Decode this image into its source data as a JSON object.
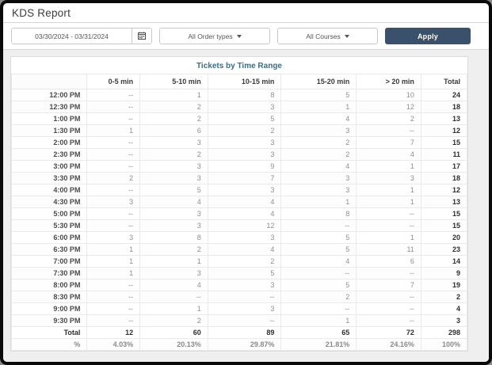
{
  "header": {
    "title": "KDS Report"
  },
  "toolbar": {
    "date_range": "03/30/2024 - 03/31/2024",
    "order_types_label": "All Order types",
    "courses_label": "All Courses",
    "apply_label": "Apply",
    "apply_color": "#3a516b"
  },
  "report": {
    "title": "Tickets by Time Range",
    "title_color": "#31708f",
    "columns": [
      "",
      "0-5 min",
      "5-10 min",
      "10-15 min",
      "15-20 min",
      "> 20 min",
      "Total"
    ],
    "rows": [
      {
        "time": "12:00 PM",
        "values": [
          "--",
          "1",
          "8",
          "5",
          "10",
          "24"
        ]
      },
      {
        "time": "12:30 PM",
        "values": [
          "--",
          "2",
          "3",
          "1",
          "12",
          "18"
        ]
      },
      {
        "time": "1:00 PM",
        "values": [
          "--",
          "2",
          "5",
          "4",
          "2",
          "13"
        ]
      },
      {
        "time": "1:30 PM",
        "values": [
          "1",
          "6",
          "2",
          "3",
          "--",
          "12"
        ]
      },
      {
        "time": "2:00 PM",
        "values": [
          "--",
          "3",
          "3",
          "2",
          "7",
          "15"
        ]
      },
      {
        "time": "2:30 PM",
        "values": [
          "--",
          "2",
          "3",
          "2",
          "4",
          "11"
        ]
      },
      {
        "time": "3:00 PM",
        "values": [
          "--",
          "3",
          "9",
          "4",
          "1",
          "17"
        ]
      },
      {
        "time": "3:30 PM",
        "values": [
          "2",
          "3",
          "7",
          "3",
          "3",
          "18"
        ]
      },
      {
        "time": "4:00 PM",
        "values": [
          "--",
          "5",
          "3",
          "3",
          "1",
          "12"
        ]
      },
      {
        "time": "4:30 PM",
        "values": [
          "3",
          "4",
          "4",
          "1",
          "1",
          "13"
        ]
      },
      {
        "time": "5:00 PM",
        "values": [
          "--",
          "3",
          "4",
          "8",
          "--",
          "15"
        ]
      },
      {
        "time": "5:30 PM",
        "values": [
          "--",
          "3",
          "12",
          "--",
          "--",
          "15"
        ]
      },
      {
        "time": "6:00 PM",
        "values": [
          "3",
          "8",
          "3",
          "5",
          "1",
          "20"
        ]
      },
      {
        "time": "6:30 PM",
        "values": [
          "1",
          "2",
          "4",
          "5",
          "11",
          "23"
        ]
      },
      {
        "time": "7:00 PM",
        "values": [
          "1",
          "1",
          "2",
          "4",
          "6",
          "14"
        ]
      },
      {
        "time": "7:30 PM",
        "values": [
          "1",
          "3",
          "5",
          "--",
          "--",
          "9"
        ]
      },
      {
        "time": "8:00 PM",
        "values": [
          "--",
          "4",
          "3",
          "5",
          "7",
          "19"
        ]
      },
      {
        "time": "8:30 PM",
        "values": [
          "--",
          "--",
          "--",
          "2",
          "--",
          "2"
        ]
      },
      {
        "time": "9:00 PM",
        "values": [
          "--",
          "1",
          "3",
          "--",
          "--",
          "4"
        ]
      },
      {
        "time": "9:30 PM",
        "values": [
          "--",
          "2",
          "--",
          "1",
          "--",
          "3"
        ]
      }
    ],
    "total_row": {
      "label": "Total",
      "values": [
        "12",
        "60",
        "89",
        "65",
        "72",
        "298"
      ]
    },
    "percent_row": {
      "label": "%",
      "values": [
        "4.03%",
        "20.13%",
        "29.87%",
        "21.81%",
        "24.16%",
        "100%"
      ]
    }
  }
}
